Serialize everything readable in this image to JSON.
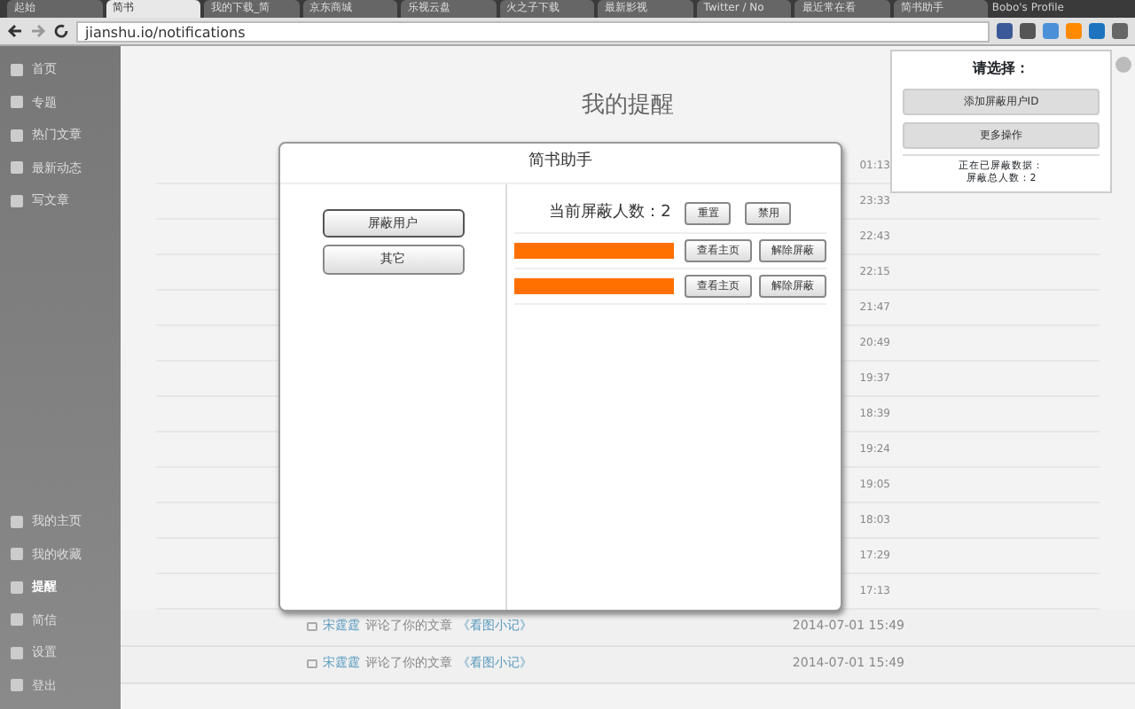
{
  "browser": {
    "tabs": [
      {
        "title": "起始",
        "selected": false
      },
      {
        "title": "简书",
        "selected": true
      },
      {
        "title": "我的下载_简",
        "selected": false
      },
      {
        "title": "京东商城",
        "selected": false
      },
      {
        "title": "乐视云盘",
        "selected": false
      },
      {
        "title": "火之子下载",
        "selected": false
      },
      {
        "title": "最新影视",
        "selected": false
      },
      {
        "title": "Twitter / No",
        "selected": false
      },
      {
        "title": "最近常在看",
        "selected": false
      },
      {
        "title": "简书助手",
        "selected": false
      }
    ],
    "profile": "Bobo's Profile",
    "address": "jianshu.io/notifications"
  },
  "sidebar": {
    "top_items": [
      {
        "label": "首页",
        "selected": false
      },
      {
        "label": "专题",
        "selected": false
      },
      {
        "label": "热门文章",
        "selected": false
      },
      {
        "label": "最新动态",
        "selected": false
      },
      {
        "label": "写文章",
        "selected": false
      }
    ],
    "bottom_items": [
      {
        "label": "我的主页",
        "selected": false
      },
      {
        "label": "我的收藏",
        "selected": false
      },
      {
        "label": "提醒",
        "selected": true
      },
      {
        "label": "简信",
        "selected": false
      },
      {
        "label": "设置",
        "selected": false
      },
      {
        "label": "登出",
        "selected": false
      }
    ]
  },
  "page_title": "我的提醒",
  "hidden_row_times": [
    "01:13",
    "23:33",
    "22:43",
    "22:15",
    "21:47",
    "20:49",
    "19:37",
    "18:39",
    "19:24",
    "19:05",
    "18:03",
    "17:29",
    "17:13"
  ],
  "notifications": [
    {
      "user": "宋霆霆",
      "action": "评论了你的文章",
      "article": "《看图小记》",
      "time": "2014-07-01 15:49"
    },
    {
      "user": "宋霆霆",
      "action": "评论了你的文章",
      "article": "《看图小记》",
      "time": "2014-07-01 15:49"
    }
  ],
  "dialog": {
    "title": "简书助手",
    "menu": [
      {
        "label": "屏蔽用户",
        "selected": true
      },
      {
        "label": "其它",
        "selected": false
      }
    ],
    "count_label": "当前屏蔽人数：2",
    "actions": [
      "重置",
      "禁用"
    ],
    "blocked_users": [
      {
        "buttons": [
          "查看主页",
          "解除屏蔽"
        ]
      },
      {
        "buttons": [
          "查看主页",
          "解除屏蔽"
        ]
      }
    ]
  },
  "popup": {
    "title": "请选择：",
    "buttons": [
      "添加屏蔽用户ID",
      "更多操作"
    ],
    "status": [
      "正在已屏蔽数据：",
      "屏蔽总人数：2"
    ]
  }
}
